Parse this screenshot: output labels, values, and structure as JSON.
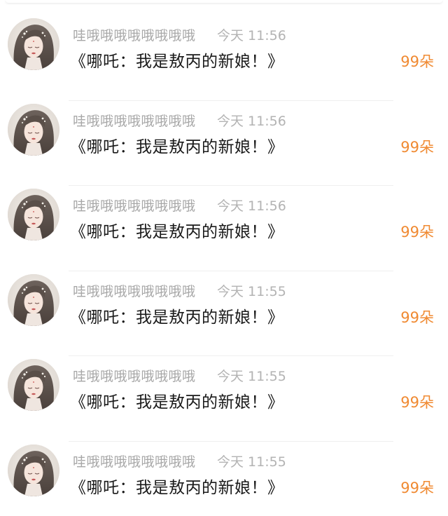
{
  "colors": {
    "username": "#a7a7a7",
    "time": "#b3b3b3",
    "message": "#1a1a1a",
    "gift_accent": "#f08a32"
  },
  "comments": [
    {
      "username": "哇哦哦哦哦哦哦哦哦",
      "time": "今天 11:56",
      "message": "《哪吒：我是敖丙的新娘！》",
      "gift": "99朵",
      "avatar_icon": "avatar-girl-portrait"
    },
    {
      "username": "哇哦哦哦哦哦哦哦哦",
      "time": "今天 11:56",
      "message": "《哪吒：我是敖丙的新娘！》",
      "gift": "99朵",
      "avatar_icon": "avatar-girl-portrait"
    },
    {
      "username": "哇哦哦哦哦哦哦哦哦",
      "time": "今天 11:56",
      "message": "《哪吒：我是敖丙的新娘！》",
      "gift": "99朵",
      "avatar_icon": "avatar-girl-portrait"
    },
    {
      "username": "哇哦哦哦哦哦哦哦哦",
      "time": "今天 11:55",
      "message": "《哪吒：我是敖丙的新娘！》",
      "gift": "99朵",
      "avatar_icon": "avatar-girl-portrait"
    },
    {
      "username": "哇哦哦哦哦哦哦哦哦",
      "time": "今天 11:55",
      "message": "《哪吒：我是敖丙的新娘！》",
      "gift": "99朵",
      "avatar_icon": "avatar-girl-portrait"
    },
    {
      "username": "哇哦哦哦哦哦哦哦哦",
      "time": "今天 11:55",
      "message": "《哪吒：我是敖丙的新娘！》",
      "gift": "99朵",
      "avatar_icon": "avatar-girl-portrait"
    }
  ]
}
